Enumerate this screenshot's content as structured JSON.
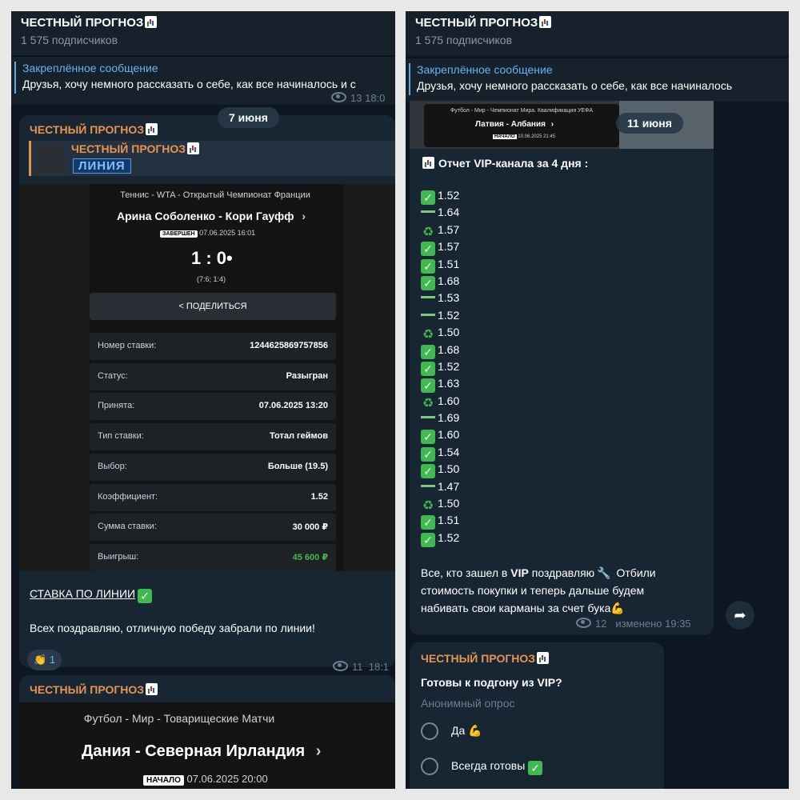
{
  "channel": {
    "name": "ЧЕСТНЫЙ ПРОГНОЗ",
    "subscribers": "1 575 подписчиков"
  },
  "pinned": {
    "title": "Закреплённое сообщение",
    "text_left": "Друзья, хочу немного рассказать о себе, как все начиналось и с",
    "text_right": "Друзья, хочу немного рассказать о себе, как все начиналось"
  },
  "left": {
    "date": "7 июня",
    "fwd_title": "ЧЕСТНЫЙ ПРОГНОЗ",
    "fwd_tag": "ЛИНИЯ",
    "bet": {
      "league": "Теннис - WTA - Открытый Чемпионат Франции",
      "match": "Арина Соболенко - Кори Гауфф",
      "status_badge": "ЗАВЕРШЕН",
      "datetime": "07.06.2025 16:01",
      "score": "1 : 0•",
      "sets": "(7:6; 1:4)",
      "share": "ПОДЕЛИТЬСЯ",
      "rows": [
        {
          "label": "Номер ставки:",
          "value": "1244625869757856"
        },
        {
          "label": "Статус:",
          "value": "Разыгран"
        },
        {
          "label": "Принята:",
          "value": "07.06.2025 13:20"
        },
        {
          "label": "Тип ставки:",
          "value": "Тотал геймов"
        },
        {
          "label": "Выбор:",
          "value": "Больше (19.5)"
        },
        {
          "label": "Коэффициент:",
          "value": "1.52"
        },
        {
          "label": "Сумма ставки:",
          "value": "30 000 ₽"
        },
        {
          "label": "Выигрыш:",
          "value": "45 600 ₽"
        }
      ]
    },
    "caption_title": "СТАВКА ПО ЛИНИИ",
    "caption_text": "Всех поздравляю, отличную победу забрали по линии!",
    "reaction_count": "1",
    "views": "11",
    "time": "18:1",
    "top_views": "13",
    "top_time": "18:0",
    "next": {
      "league": "Футбол - Мир - Товарищеские Матчи",
      "match": "Дания - Северная Ирландия",
      "badge": "НАЧАЛО",
      "datetime": "07.06.2025 20:00"
    }
  },
  "right": {
    "date": "11 июня",
    "preview": {
      "league": "Футбол - Мир - Чемпионат Мира. Квалификация УЕФА",
      "match": "Латвия - Албания",
      "badge": "НАЧАЛО",
      "datetime": "10.06.2025 21:45"
    },
    "report_title": "Отчет VIP-канала за 4 дня :",
    "results": [
      {
        "mark": "win",
        "odds": "1.52"
      },
      {
        "mark": "push",
        "odds": "1.64"
      },
      {
        "mark": "refund",
        "odds": "1.57"
      },
      {
        "mark": "win",
        "odds": "1.57"
      },
      {
        "mark": "win",
        "odds": "1.51"
      },
      {
        "mark": "win",
        "odds": "1.68"
      },
      {
        "mark": "push",
        "odds": "1.53"
      },
      {
        "mark": "push",
        "odds": "1.52"
      },
      {
        "mark": "refund",
        "odds": "1.50"
      },
      {
        "mark": "win",
        "odds": "1.68"
      },
      {
        "mark": "win",
        "odds": "1.52"
      },
      {
        "mark": "win",
        "odds": "1.63"
      },
      {
        "mark": "refund",
        "odds": "1.60"
      },
      {
        "mark": "push",
        "odds": "1.69"
      },
      {
        "mark": "win",
        "odds": "1.60"
      },
      {
        "mark": "win",
        "odds": "1.54"
      },
      {
        "mark": "win",
        "odds": "1.50"
      },
      {
        "mark": "push",
        "odds": "1.47"
      },
      {
        "mark": "refund",
        "odds": "1.50"
      },
      {
        "mark": "win",
        "odds": "1.51"
      },
      {
        "mark": "win",
        "odds": "1.52"
      }
    ],
    "footer_line1_a": "Все, кто зашел в ",
    "footer_line1_b": "VIP",
    "footer_line1_c": " поздравляю",
    "footer_line1_d": " Отбили",
    "footer_line2": "стоимость покупки и теперь дальше будем",
    "footer_line3": "набивать свои карманы за счет бука",
    "views": "12",
    "edited": "изменено 19:35",
    "poll": {
      "question": "Готовы к подгону из VIP?",
      "type": "Анонимный опрос",
      "options": [
        "Да",
        "Всегда готовы"
      ]
    }
  },
  "colors": {
    "background": "#0e1621",
    "bubble": "#182533",
    "author": "#e7944f",
    "link": "#64b5f6",
    "win_green": "#3fb950"
  }
}
